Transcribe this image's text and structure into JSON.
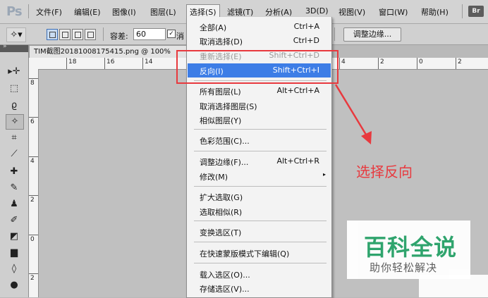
{
  "app": {
    "logo": "Ps",
    "bridge_badge": "Br"
  },
  "menubar": {
    "items": [
      "文件(F)",
      "编辑(E)",
      "图像(I)",
      "图层(L)",
      "选择(S)",
      "滤镜(T)",
      "分析(A)",
      "3D(D)",
      "视图(V)",
      "窗口(W)",
      "帮助(H)"
    ],
    "active": "选择(S)"
  },
  "options": {
    "tolerance_label": "容差:",
    "tolerance_value": "60",
    "checkbox_label": "消",
    "refine_edge_button": "调整边缘..."
  },
  "toolbox": {
    "collapse_glyph": "»"
  },
  "document": {
    "tab_title": "TIM截图20181008175415.png @ 100%",
    "ruler_top_labels": [
      "18",
      "16",
      "14",
      "4",
      "2",
      "0",
      "2"
    ],
    "ruler_left_labels": [
      "8",
      "6",
      "4",
      "2",
      "0",
      "2"
    ]
  },
  "select_menu": {
    "items": [
      {
        "label": "全部(A)",
        "shortcut": "Ctrl+A",
        "state": "normal"
      },
      {
        "label": "取消选择(D)",
        "shortcut": "Ctrl+D",
        "state": "normal"
      },
      {
        "label": "重新选择(E)",
        "shortcut": "Shift+Ctrl+D",
        "state": "disabled"
      },
      {
        "label": "反向(I)",
        "shortcut": "Shift+Ctrl+I",
        "state": "highlight"
      },
      {
        "label": "所有图层(L)",
        "shortcut": "Alt+Ctrl+A",
        "state": "normal"
      },
      {
        "label": "取消选择图层(S)",
        "shortcut": "",
        "state": "normal"
      },
      {
        "label": "相似图层(Y)",
        "shortcut": "",
        "state": "normal"
      },
      {
        "label": "色彩范围(C)...",
        "shortcut": "",
        "state": "normal"
      },
      {
        "label": "调整边缘(F)...",
        "shortcut": "Alt+Ctrl+R",
        "state": "normal"
      },
      {
        "label": "修改(M)",
        "shortcut": "",
        "state": "submenu"
      },
      {
        "label": "扩大选取(G)",
        "shortcut": "",
        "state": "normal"
      },
      {
        "label": "选取相似(R)",
        "shortcut": "",
        "state": "normal"
      },
      {
        "label": "变换选区(T)",
        "shortcut": "",
        "state": "normal"
      },
      {
        "label": "在快速蒙版模式下编辑(Q)",
        "shortcut": "",
        "state": "normal"
      },
      {
        "label": "载入选区(O)...",
        "shortcut": "",
        "state": "normal"
      },
      {
        "label": "存储选区(V)...",
        "shortcut": "",
        "state": "normal"
      }
    ],
    "submenu_glyph": "▸"
  },
  "annotation": {
    "text": "选择反向",
    "color": "#e8393e"
  },
  "watermark": {
    "title": "百科全说",
    "subtitle": "助你轻松解决",
    "color": "#2aa36a"
  }
}
